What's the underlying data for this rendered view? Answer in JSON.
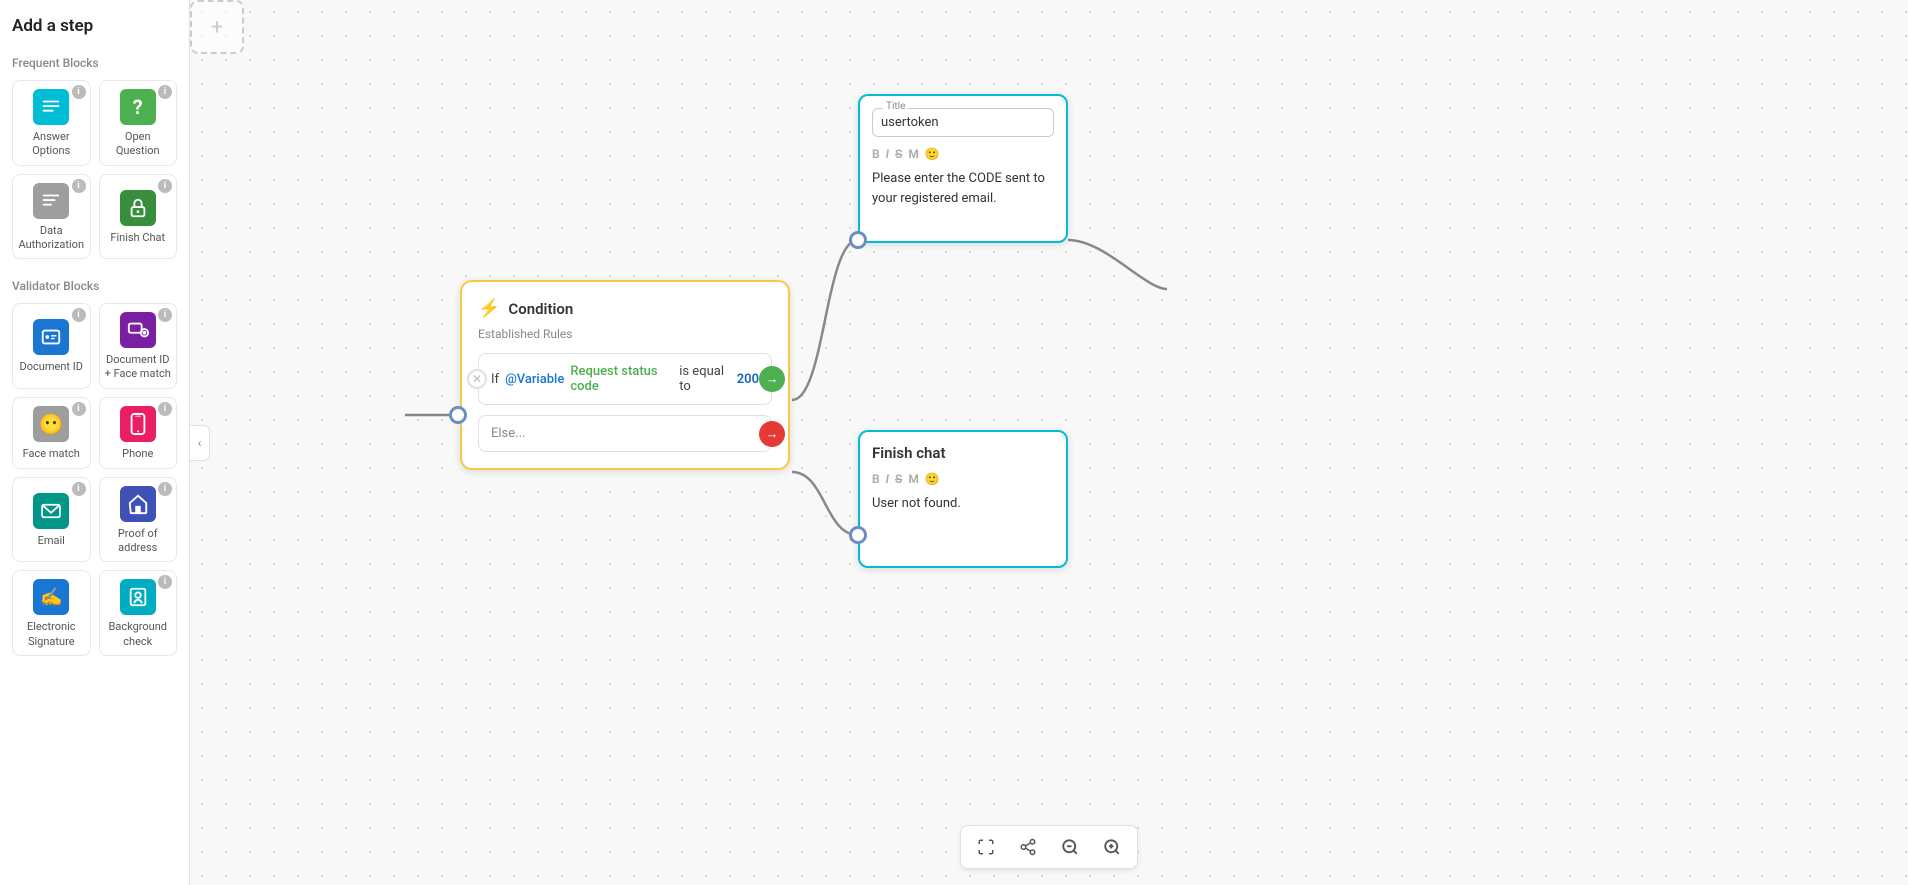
{
  "sidebar": {
    "title": "Add a step",
    "frequent_label": "Frequent Blocks",
    "validator_label": "Validator Blocks",
    "frequent_blocks": [
      {
        "id": "answer-options",
        "label": "Answer Options",
        "icon": "☰",
        "color": "teal"
      },
      {
        "id": "open-question",
        "label": "Open Question",
        "icon": "?",
        "color": "green"
      },
      {
        "id": "data-auth",
        "label": "Data Authorization",
        "icon": "≡",
        "color": "gray"
      },
      {
        "id": "finish-chat",
        "label": "Finish Chat",
        "icon": "🔒",
        "color": "green-dark"
      }
    ],
    "validator_blocks": [
      {
        "id": "document-id",
        "label": "Document ID",
        "icon": "🪪",
        "color": "blue"
      },
      {
        "id": "document-face",
        "label": "Document ID + Face match",
        "icon": "🪪",
        "color": "purple"
      },
      {
        "id": "face-match",
        "label": "Face match",
        "icon": "😶",
        "color": "gray"
      },
      {
        "id": "phone",
        "label": "Phone",
        "icon": "📱",
        "color": "pink"
      },
      {
        "id": "email",
        "label": "Email",
        "icon": "✉",
        "color": "teal2"
      },
      {
        "id": "proof-address",
        "label": "Proof of address",
        "icon": "🏠",
        "color": "indigo"
      },
      {
        "id": "electronic-sig",
        "label": "Electronic Signature",
        "icon": "✍",
        "color": "blue"
      },
      {
        "id": "background-check",
        "label": "Background check",
        "icon": "🔍",
        "color": "cyan"
      }
    ]
  },
  "canvas": {
    "condition_node": {
      "title": "Condition",
      "subtitle": "Established Rules",
      "rule_text": "If",
      "rule_var": "@Variable",
      "rule_highlight": "Request status code",
      "rule_equal": "is equal to",
      "rule_value": "200",
      "else_label": "Else..."
    },
    "message_node": {
      "field_label": "Title",
      "title": "usertoken",
      "body": "Please enter the CODE sent to your registered email."
    },
    "finish_node": {
      "title": "Finish chat",
      "body": "User not found."
    },
    "plus_node": {
      "symbol": "+"
    }
  },
  "toolbar": {
    "buttons": [
      {
        "id": "fit",
        "icon": "⊞",
        "label": "fit screen"
      },
      {
        "id": "share",
        "icon": "⎇",
        "label": "share"
      },
      {
        "id": "zoom-out",
        "icon": "−",
        "label": "zoom out"
      },
      {
        "id": "zoom-in",
        "icon": "+",
        "label": "zoom in"
      }
    ]
  },
  "colors": {
    "teal": "#00bcd4",
    "green": "#4caf50",
    "yellow": "#f9c846",
    "red": "#e53935",
    "blue": "#1976d2"
  }
}
